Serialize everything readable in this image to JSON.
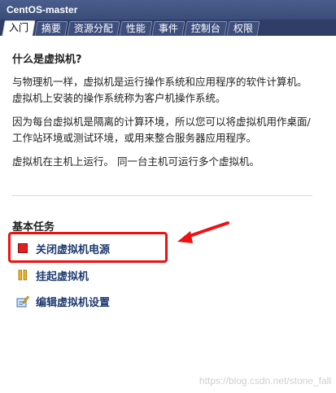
{
  "window": {
    "title": "CentOS-master"
  },
  "tabs": [
    {
      "label": "入门",
      "active": true
    },
    {
      "label": "摘要",
      "active": false
    },
    {
      "label": "资源分配",
      "active": false
    },
    {
      "label": "性能",
      "active": false
    },
    {
      "label": "事件",
      "active": false
    },
    {
      "label": "控制台",
      "active": false
    },
    {
      "label": "权限",
      "active": false
    }
  ],
  "intro": {
    "heading": "什么是虚拟机?",
    "paragraphs": [
      "与物理机一样，虚拟机是运行操作系统和应用程序的软件计算机。 虚拟机上安装的操作系统称为客户机操作系统。",
      "因为每台虚拟机是隔离的计算环境，所以您可以将虚拟机用作桌面/工作站环境或测试环境，或用来整合服务器应用程序。",
      "虚拟机在主机上运行。 同一台主机可运行多个虚拟机。"
    ]
  },
  "tasks": {
    "heading": "基本任务",
    "items": [
      {
        "label": "关闭虚拟机电源",
        "icon": "power-off-icon",
        "color": "#e02020"
      },
      {
        "label": "挂起虚拟机",
        "icon": "pause-icon",
        "color": "#e8a417"
      },
      {
        "label": "编辑虚拟机设置",
        "icon": "edit-settings-icon",
        "color": "#3a6fb0"
      }
    ]
  },
  "annotation": {
    "box_color": "#ee1111"
  },
  "watermark": "https://blog.csdn.net/stone_fall"
}
